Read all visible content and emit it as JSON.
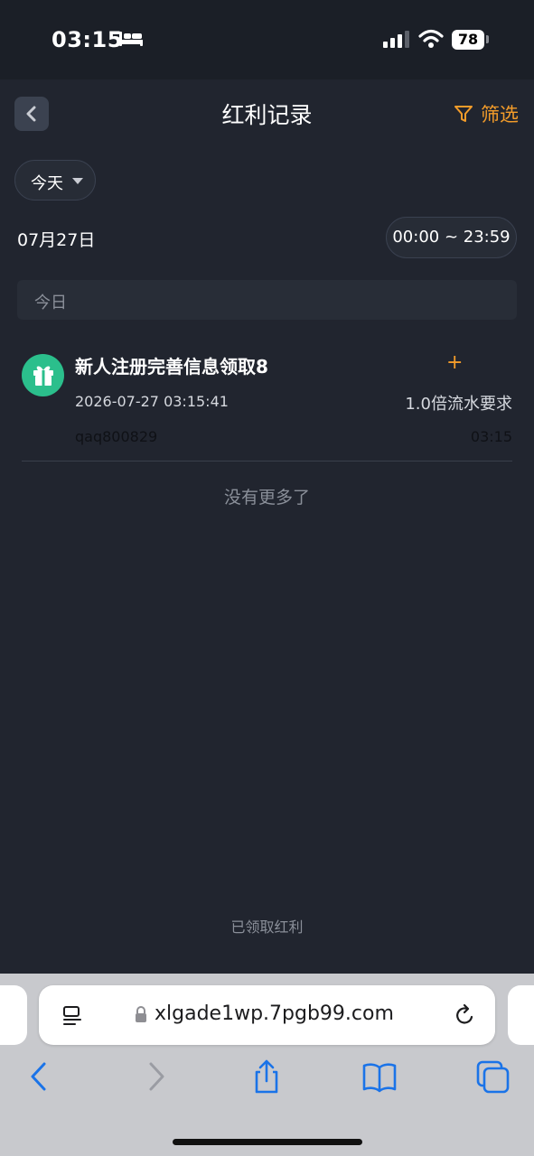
{
  "status_bar": {
    "time": "03:15",
    "battery": "78"
  },
  "header": {
    "title": "红利记录",
    "filter_label": "筛选"
  },
  "filters": {
    "date_range": "今天",
    "current_date": "07月27日",
    "time_range": "00:00 ~ 23:59"
  },
  "section": {
    "label": "今日"
  },
  "records": [
    {
      "title": "新人注册完善信息领取8",
      "amount": "+",
      "datetime": "2026-07-27 03:15:41",
      "wager": "1.0倍流水要求",
      "username": "qaq800829",
      "time": "03:15"
    }
  ],
  "no_more_text": "没有更多了",
  "footer_label": "已领取红利",
  "browser": {
    "url": "xlgade1wp.7pgb99.com"
  },
  "colors": {
    "accent": "#f39c2a",
    "background": "#21252f",
    "gift_icon_bg": "#2bbf8c",
    "browser_blue": "#1a73e8"
  }
}
